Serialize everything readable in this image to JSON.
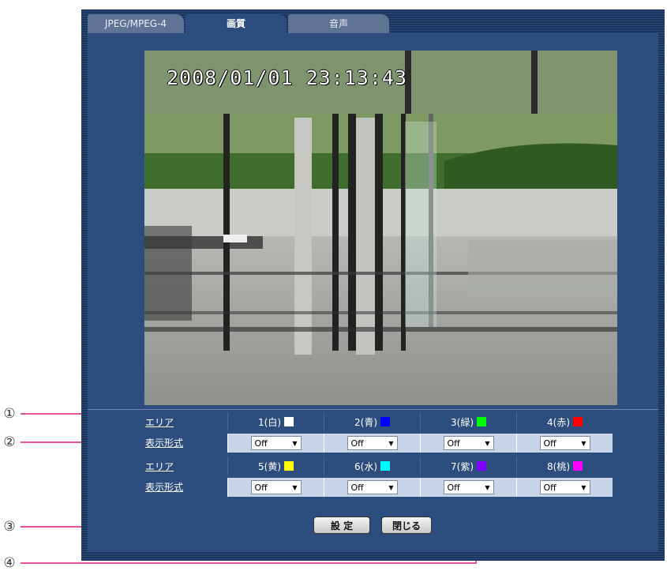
{
  "tabs": [
    {
      "label": "JPEG/MPEG-4"
    },
    {
      "label": "画質"
    },
    {
      "label": "音声"
    }
  ],
  "camera": {
    "timestamp": "2008/01/01  23:13:43"
  },
  "callouts": [
    "①",
    "②",
    "③",
    "④"
  ],
  "table": {
    "area_label": "エリア",
    "format_label": "表示形式",
    "areas_row1": [
      {
        "label": "1(白)",
        "color": "#ffffff"
      },
      {
        "label": "2(青)",
        "color": "#0000ff"
      },
      {
        "label": "3(緑)",
        "color": "#00ff00"
      },
      {
        "label": "4(赤)",
        "color": "#ff0000"
      }
    ],
    "areas_row2": [
      {
        "label": "5(黄)",
        "color": "#ffff00"
      },
      {
        "label": "6(水)",
        "color": "#00ffff"
      },
      {
        "label": "7(紫)",
        "color": "#8000ff"
      },
      {
        "label": "8(桃)",
        "color": "#ff00ff"
      }
    ],
    "format_row1": [
      "Off",
      "Off",
      "Off",
      "Off"
    ],
    "format_row2": [
      "Off",
      "Off",
      "Off",
      "Off"
    ]
  },
  "buttons": {
    "set": "設 定",
    "close": "閉じる"
  },
  "accent_color": "#e2559b"
}
